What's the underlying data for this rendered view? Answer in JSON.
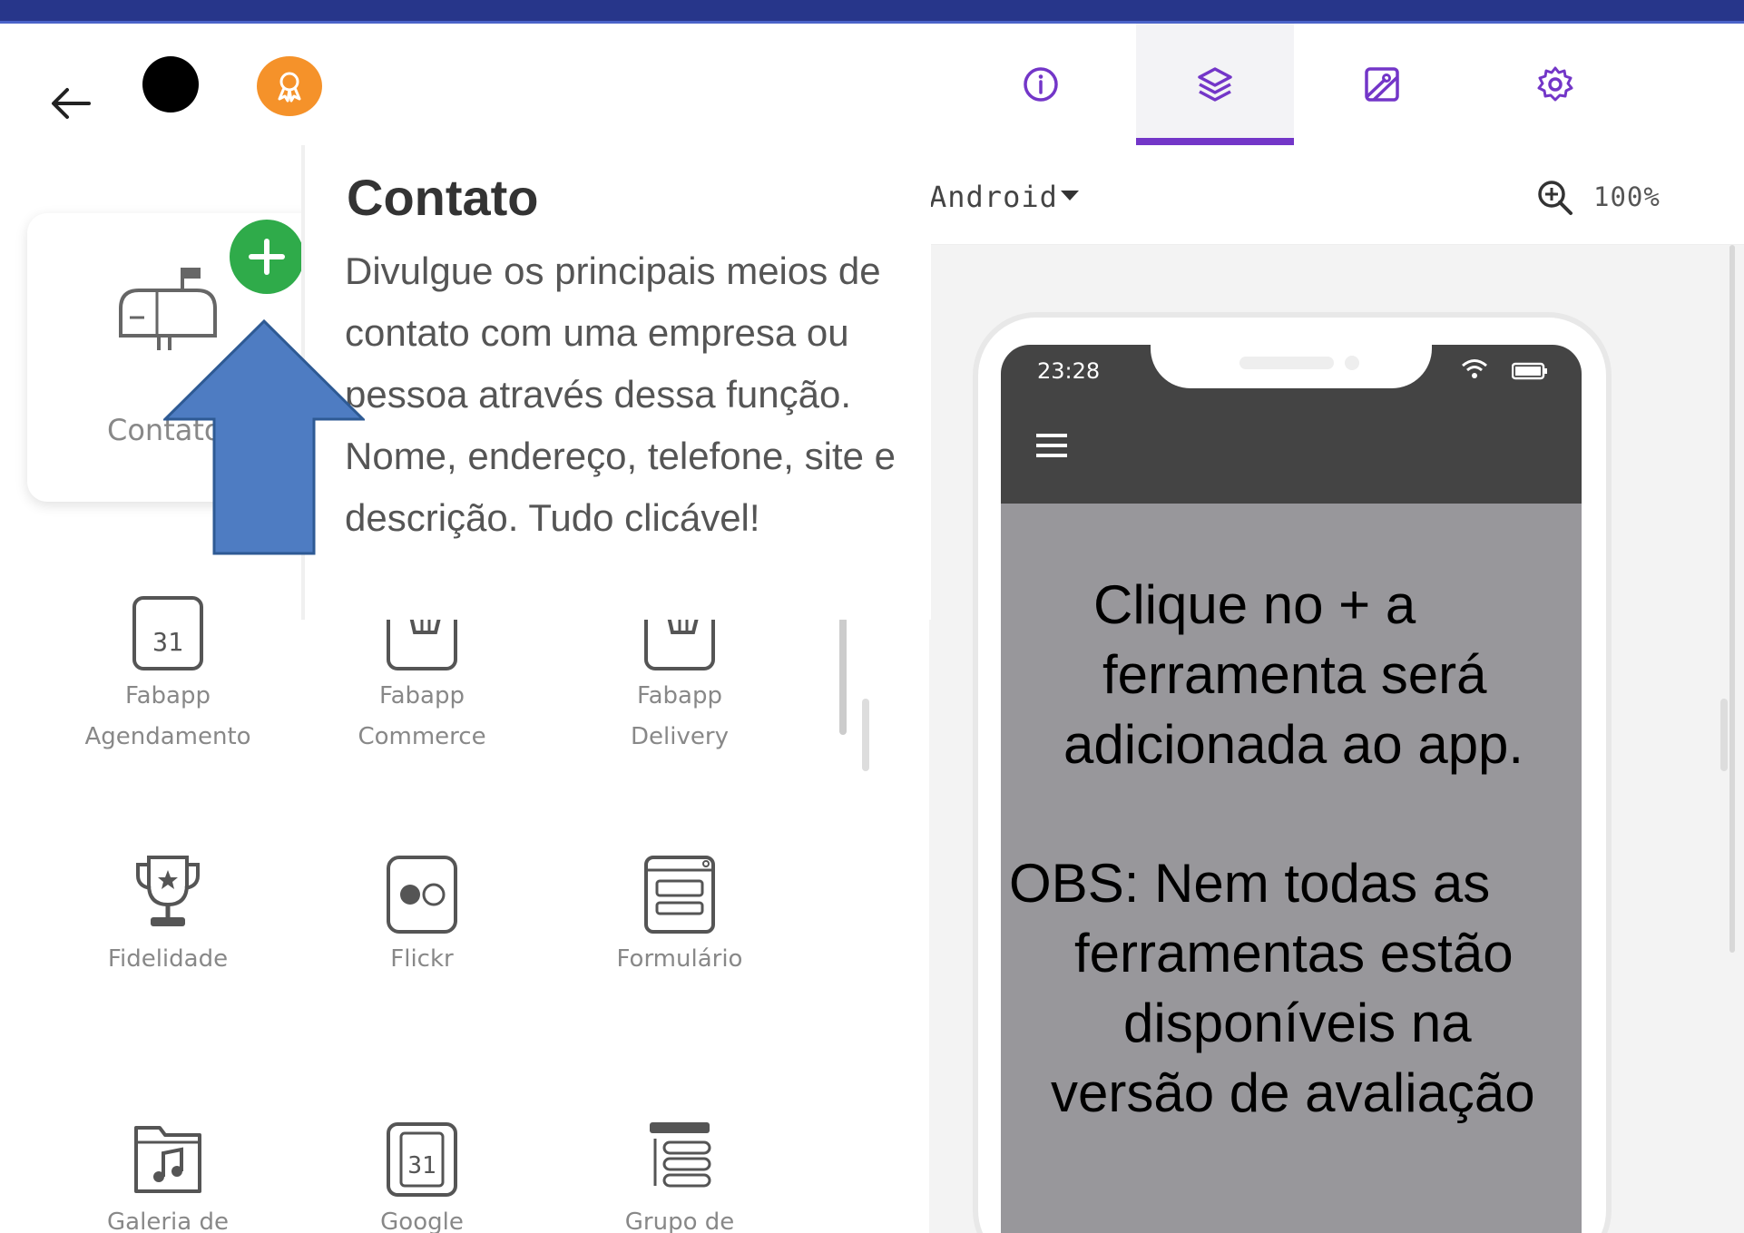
{
  "header": {
    "tabs": [
      {
        "name": "info",
        "icon": "info-icon",
        "active": false
      },
      {
        "name": "layers",
        "icon": "layers-icon",
        "active": true
      },
      {
        "name": "image",
        "icon": "image-icon",
        "active": false
      },
      {
        "name": "settings",
        "icon": "gear-icon",
        "active": false
      }
    ],
    "accent_color": "#7336c8",
    "badge_color": "#f5922a"
  },
  "toolbar": {
    "platform": "Android",
    "zoom": "100%"
  },
  "tool_card": {
    "label": "Contato",
    "icon": "mailbox-icon",
    "add_icon": "plus-icon"
  },
  "tooltip": {
    "title": "Contato",
    "body": "Divulgue os principais meios de contato com uma empresa ou pessoa através dessa função. Nome, endereço, telefone, site e descrição. Tudo clicável!"
  },
  "tools": [
    {
      "label_1": "Fabapp",
      "label_2": "Agendamento",
      "icon": "calendar-icon"
    },
    {
      "label_1": "Fabapp",
      "label_2": "Commerce",
      "icon": "cart-icon"
    },
    {
      "label_1": "Fabapp",
      "label_2": "Delivery",
      "icon": "cart-icon"
    },
    {
      "label_1": "Fidelidade",
      "label_2": "",
      "icon": "trophy-icon"
    },
    {
      "label_1": "Flickr",
      "label_2": "",
      "icon": "flickr-icon"
    },
    {
      "label_1": "Formulário",
      "label_2": "",
      "icon": "form-icon"
    },
    {
      "label_1": "Galeria de",
      "label_2": "",
      "icon": "music-folder-icon"
    },
    {
      "label_1": "Google",
      "label_2": "",
      "icon": "calendar-icon"
    },
    {
      "label_1": "Grupo de",
      "label_2": "",
      "icon": "list-icon"
    }
  ],
  "phone": {
    "time": "23:28"
  },
  "annotation": {
    "line_1": "Clique no + a",
    "line_2": "ferramenta será",
    "line_3": "adicionada ao app.",
    "line_4": "OBS: Nem todas as",
    "line_5": "ferramentas estão",
    "line_6": "disponíveis na",
    "line_7": "versão de avaliação"
  }
}
